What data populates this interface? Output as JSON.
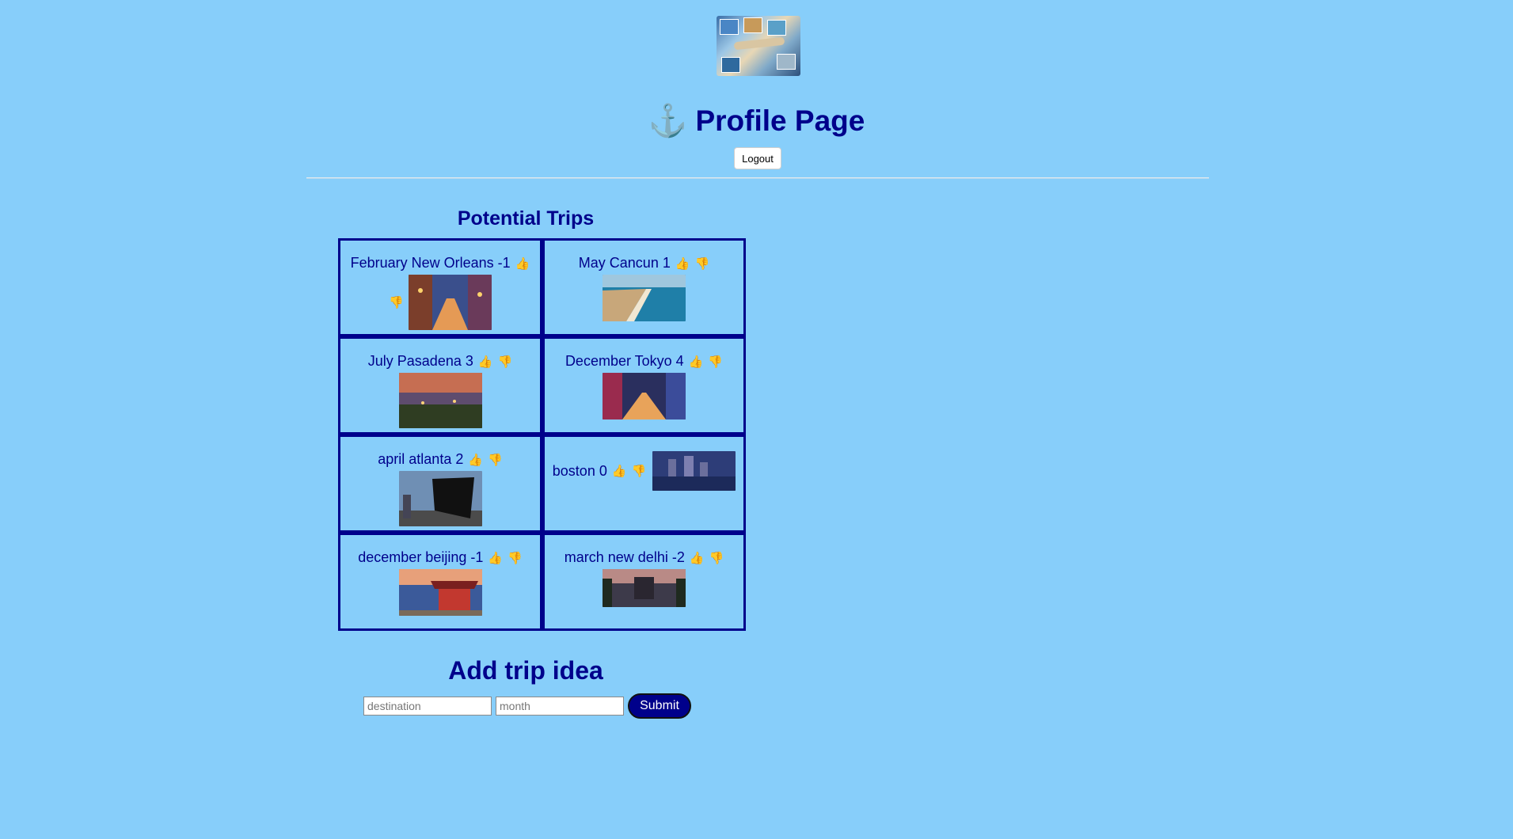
{
  "header": {
    "title": "Profile Page",
    "icon": "anchor-icon",
    "logout_label": "Logout"
  },
  "trips_section": {
    "title": "Potential Trips"
  },
  "trips": [
    {
      "label": "February New Orleans -1",
      "image": "new-orleans-street"
    },
    {
      "label": "May Cancun 1",
      "image": "cancun-coast"
    },
    {
      "label": "July Pasadena 3",
      "image": "pasadena-night"
    },
    {
      "label": "December Tokyo 4",
      "image": "tokyo-street"
    },
    {
      "label": "april atlanta 2",
      "image": "atlanta-sculpture"
    },
    {
      "label": "boston 0",
      "image": "boston-skyline"
    },
    {
      "label": "december beijing -1",
      "image": "beijing-pagoda"
    },
    {
      "label": "march new delhi -2",
      "image": "new-delhi-monument"
    }
  ],
  "add_section": {
    "title": "Add trip idea",
    "destination_placeholder": "destination",
    "month_placeholder": "month",
    "submit_label": "Submit"
  },
  "colors": {
    "background": "#87cefa",
    "accent": "#00008b"
  }
}
